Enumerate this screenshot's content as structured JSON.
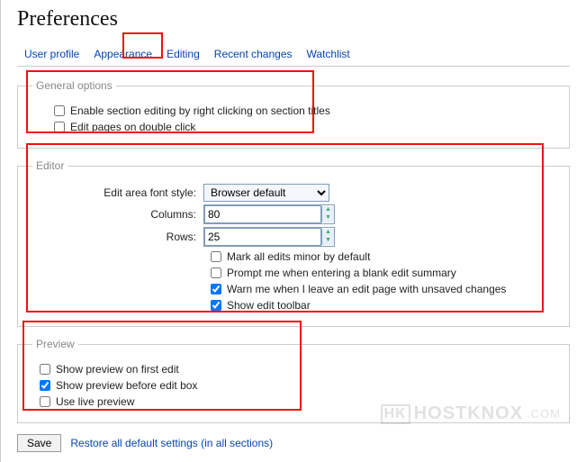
{
  "title": "Preferences",
  "tabs": {
    "items": [
      "User profile",
      "Appearance",
      "Editing",
      "Recent changes",
      "Watchlist"
    ],
    "active": 2
  },
  "general": {
    "legend": "General options",
    "items": [
      {
        "label": "Enable section editing by right clicking on section titles",
        "checked": false
      },
      {
        "label": "Edit pages on double click",
        "checked": false
      }
    ]
  },
  "editor": {
    "legend": "Editor",
    "font_label": "Edit area font style:",
    "font_value": "Browser default",
    "columns_label": "Columns:",
    "columns_value": "80",
    "rows_label": "Rows:",
    "rows_value": "25",
    "checks": [
      {
        "label": "Mark all edits minor by default",
        "checked": false
      },
      {
        "label": "Prompt me when entering a blank edit summary",
        "checked": false
      },
      {
        "label": "Warn me when I leave an edit page with unsaved changes",
        "checked": true
      },
      {
        "label": "Show edit toolbar",
        "checked": true
      }
    ]
  },
  "preview": {
    "legend": "Preview",
    "items": [
      {
        "label": "Show preview on first edit",
        "checked": false
      },
      {
        "label": "Show preview before edit box",
        "checked": true
      },
      {
        "label": "Use live preview",
        "checked": false
      }
    ]
  },
  "footer": {
    "save_label": "Save",
    "restore_label": "Restore all default settings (in all sections)"
  },
  "watermark": "HOSTKNOX"
}
